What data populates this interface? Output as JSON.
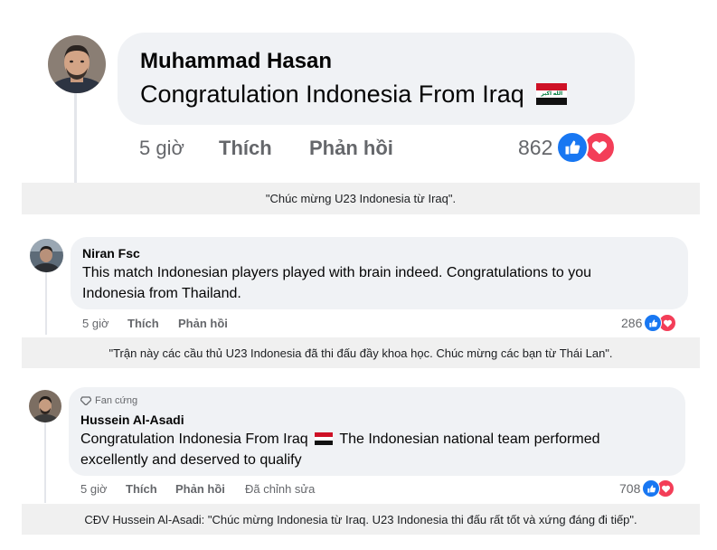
{
  "comments": [
    {
      "author": "Muhammad Hasan",
      "text": "Congratulation Indonesia From Iraq",
      "time": "5 giờ",
      "like_label": "Thích",
      "reply_label": "Phản hồi",
      "reaction_count": "862",
      "caption": "\"Chúc mừng U23 Indonesia từ Iraq\"."
    },
    {
      "author": "Niran Fsc",
      "text_line1": "This match Indonesian players played with brain indeed. Congratulations to you",
      "text_line2": "Indonesia from Thailand.",
      "time": "5 giờ",
      "like_label": "Thích",
      "reply_label": "Phản hồi",
      "reaction_count": "286",
      "caption": "\"Trận này các cầu thủ U23 Indonesia đã thi đấu đầy khoa học. Chúc mừng các bạn từ Thái Lan\"."
    },
    {
      "badge": "Fan cứng",
      "author": "Hussein Al-Asadi",
      "text_line1a": "Congratulation Indonesia From Iraq",
      "text_line1b": "The Indonesian national team performed",
      "text_line2": "excellently and deserved to qualify",
      "time": "5 giờ",
      "like_label": "Thích",
      "reply_label": "Phản hồi",
      "edited_label": "Đã chỉnh sửa",
      "reaction_count": "708",
      "caption": "CĐV Hussein Al-Asadi: \"Chúc mừng Indonesia từ Iraq. U23 Indonesia thi đấu rất tốt và xứng đáng đi tiếp\"."
    }
  ],
  "flag_text": "الله اكبر",
  "colors": {
    "like": "#1877f2",
    "love": "#f33e58",
    "bubble": "#f0f2f5",
    "caption_bg": "#f0f0f0",
    "meta": "#65676b"
  },
  "icons": {
    "like": "thumbs-up-icon",
    "love": "heart-icon",
    "badge": "diamond-icon"
  }
}
